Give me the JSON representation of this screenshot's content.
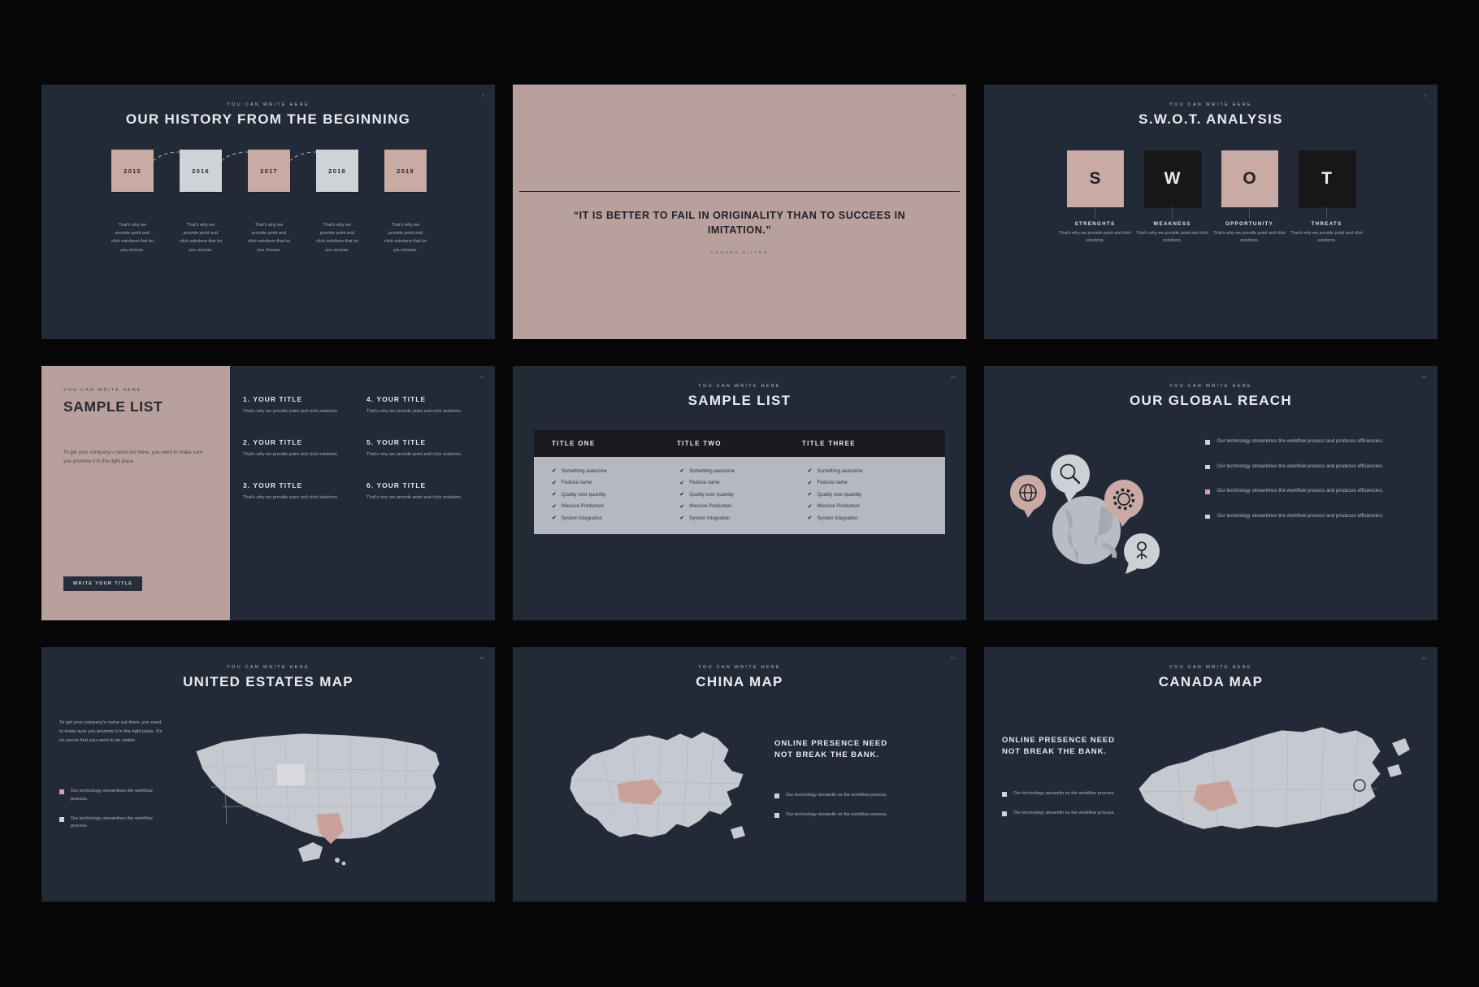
{
  "theme": {
    "background": "#070708",
    "slide_bg": "#222a38",
    "rose": "#b8a09d",
    "rose_box": "#c9aaa4",
    "grey_box": "#cfd2d6",
    "dark_box": "#17171a",
    "heading": "#e9ebee",
    "body": "#a7acb6"
  },
  "common": {
    "eyebrow": "YOU CAN WRITE HERE",
    "body_snippet": "That's why we provide point and click solutions.",
    "check_icon": "✔"
  },
  "slides": [
    {
      "id": "history",
      "number": "5",
      "eyebrow": "YOU CAN WRITE HERE",
      "title": "OUR HISTORY FROM THE BEGINNING",
      "milestones": [
        {
          "year": "2015",
          "tone": "rose",
          "text": "That's why we provide point and click solutions that let you choose."
        },
        {
          "year": "2016",
          "tone": "grey",
          "text": "That's why we provide point and click solutions that let you choose."
        },
        {
          "year": "2017",
          "tone": "rose",
          "text": "That's why we provide point and click solutions that let you choose."
        },
        {
          "year": "2018",
          "tone": "grey",
          "text": "That's why we provide point and click solutions that let you choose."
        },
        {
          "year": "2019",
          "tone": "rose",
          "text": "That's why we provide point and click solutions that let you choose."
        }
      ]
    },
    {
      "id": "quote",
      "number": "5",
      "quote": "“IT IS BETTER TO FAIL IN ORIGINALITY THAN TO SUCCEES IN IMITATION.”",
      "author": "CONORD HILTON"
    },
    {
      "id": "swot",
      "number": "6",
      "eyebrow": "YOU CAN WRITE HERE",
      "title": "S.W.O.T. ANALYSIS",
      "items": [
        {
          "letter": "S",
          "tone": "rose",
          "label": "STRENGHTS",
          "text": "That's why we provide point and click solutions."
        },
        {
          "letter": "W",
          "tone": "dark",
          "label": "WEAKNESS",
          "text": "That's why we provide point and click solutions."
        },
        {
          "letter": "O",
          "tone": "rose",
          "label": "OPPORTUNITY",
          "text": "That's why we provide point and click solutions."
        },
        {
          "letter": "T",
          "tone": "dark",
          "label": "THREATS",
          "text": "That's why we provide point and click solutions."
        }
      ]
    },
    {
      "id": "sample-list-split",
      "number": "11",
      "eyebrow": "YOU CAN WRITE HERE",
      "title": "SAMPLE LIST",
      "intro": "To get your company's name out there, you need to make sure you promote it in the right place.",
      "button": "WRITE YOUR TITLE",
      "items": [
        {
          "heading": "1. YOUR TITLE",
          "text": "That's why we provide point and click solutions."
        },
        {
          "heading": "4. YOUR TITLE",
          "text": "That's why we provide point and click solutions."
        },
        {
          "heading": "2. YOUR TITLE",
          "text": "That's why we provide point and click solutions."
        },
        {
          "heading": "5. YOUR TITLE",
          "text": "That's why we provide point and click solutions."
        },
        {
          "heading": "3. YOUR TITLE",
          "text": "That's why we provide point and click solutions."
        },
        {
          "heading": "6. YOUR TITLE",
          "text": "That's why we provide point and click solutions."
        }
      ]
    },
    {
      "id": "sample-list-table",
      "number": "12",
      "eyebrow": "YOU CAN WRITE HERE",
      "title": "SAMPLE LIST",
      "columns": [
        "TITLE ONE",
        "TITLE TWO",
        "TITLE THREE"
      ],
      "rows": [
        [
          "Something awesome",
          "Something awesome",
          "Something awesome"
        ],
        [
          "Feature name",
          "Feature name",
          "Feature name"
        ],
        [
          "Quality over quantity",
          "Quality over quantity",
          "Quality over quantity"
        ],
        [
          "Massive Production",
          "Massive Production",
          "Massive Production"
        ],
        [
          "System Integration",
          "System Integration",
          "System Integration"
        ]
      ]
    },
    {
      "id": "global-reach",
      "number": "26",
      "eyebrow": "YOU CAN WRITE HERE",
      "title": "OUR GLOBAL REACH",
      "icons": [
        "globe-icon",
        "search-icon",
        "gear-icon",
        "user-icon"
      ],
      "bullets": [
        {
          "tone": "grey",
          "text": "Our technology streamlines the workflow process and produces efficiencies."
        },
        {
          "tone": "grey",
          "text": "Our technology streamlines the workflow process and produces efficiencies."
        },
        {
          "tone": "rose",
          "text": "Our technology streamlines the workflow process and produces efficiencies."
        },
        {
          "tone": "grey",
          "text": "Our technology streamlines the workflow process and produces efficiencies."
        }
      ]
    },
    {
      "id": "map-us",
      "number": "36",
      "eyebrow": "YOU CAN WRITE HERE",
      "title": "UNITED ESTATES MAP",
      "lead": "To get your company's name out there, you need to make sure you promote it in the right place. It's no secret that you need to be visible.",
      "bullets": [
        {
          "tone": "rose",
          "text": "Our technology streamlines the workflow process."
        },
        {
          "tone": "grey",
          "text": "Our technology streamlines the workflow process.."
        }
      ]
    },
    {
      "id": "map-china",
      "number": "37",
      "eyebrow": "YOU CAN WRITE HERE",
      "title": "CHINA MAP",
      "heading": "ONLINE PRESENCE NEED NOT BREAK THE BANK.",
      "bullets": [
        {
          "tone": "grey",
          "text": "Our technology streamlin es the workflow process."
        },
        {
          "tone": "grey",
          "text": "Our technology streamlin es the workflow process."
        }
      ]
    },
    {
      "id": "map-canada",
      "number": "38",
      "eyebrow": "YOU CAN WRITE HERE",
      "title": "CANADA MAP",
      "heading": "ONLINE PRESENCE NEED NOT BREAK THE BANK.",
      "bullets": [
        {
          "tone": "grey",
          "text": "Our technology streamlin es the workflow process."
        },
        {
          "tone": "grey",
          "text": "Our technology streamlin es the workflow process."
        }
      ]
    }
  ]
}
